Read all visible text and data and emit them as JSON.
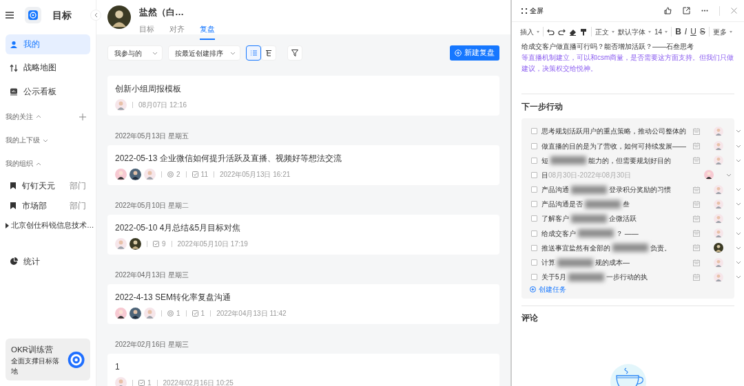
{
  "app": {
    "title": "目标"
  },
  "sidebar": {
    "nav": [
      {
        "label": "我的",
        "selected": true
      },
      {
        "label": "战略地图",
        "selected": false
      },
      {
        "label": "公示看板",
        "selected": false
      }
    ],
    "groups": [
      {
        "label": "我的关注",
        "expanded": true,
        "can_add": true
      },
      {
        "label": "我的上下级",
        "expanded": false,
        "can_add": false
      },
      {
        "label": "我的组织",
        "expanded": true,
        "can_add": false,
        "items": [
          {
            "kind": "dept",
            "label": "钉钉天元",
            "tag": "部门"
          },
          {
            "kind": "dept",
            "label": "市场部",
            "tag": "部门"
          },
          {
            "kind": "tree",
            "label": "北京创仕科锐信息技术…"
          }
        ]
      }
    ],
    "stats": {
      "label": "统计"
    },
    "promo": {
      "title": "OKR训练营",
      "subtitle": "全面支撑目标落地"
    }
  },
  "header": {
    "user": "盐然（白…",
    "tabs": [
      {
        "label": "目标",
        "selected": false
      },
      {
        "label": "对齐",
        "selected": false
      },
      {
        "label": "复盘",
        "selected": true
      }
    ]
  },
  "toolbar": {
    "filters": [
      "我参与的",
      "按最近创建排序"
    ],
    "views": [
      {
        "kind": "list",
        "selected": true
      },
      {
        "kind": "tree",
        "selected": false
      }
    ],
    "new_button": "新建复盘"
  },
  "reviews": [
    {
      "title": "创新小组周报模板",
      "time": "08月07日 12:16"
    },
    {
      "date": "2022年05月13日 星期五",
      "title": "2022-05-13 企业微信如何提升活跃及直播、视频好等想法交流",
      "objectives": "2",
      "tasks": "11",
      "time": "2022年05月13日 16:21"
    },
    {
      "date": "2022年05月10日 星期二",
      "title": "2022-05-10 4月总结&5月目标对焦",
      "tasks": "9",
      "time": "2022年05月10日 17:19"
    },
    {
      "date": "2022年04月13日 星期三",
      "title": "2022-4-13 SEM转化率复盘沟通",
      "objectives": "1",
      "tasks": "1",
      "time": "2022年04月13日 11:42"
    },
    {
      "date": "2022年02月16日 星期三",
      "title": "1",
      "tasks": "1",
      "time": "2022年02月16日 10:25"
    }
  ],
  "panel": {
    "fullscreen": "全屏",
    "editor_toolbar": [
      {
        "kind": "menu",
        "label": "插入"
      },
      {
        "kind": "sep"
      },
      {
        "kind": "icon"
      },
      {
        "kind": "icon"
      },
      {
        "kind": "icon"
      },
      {
        "kind": "icon"
      },
      {
        "kind": "sep"
      },
      {
        "kind": "menu",
        "label": "正文"
      },
      {
        "kind": "menu",
        "label": "默认字体"
      },
      {
        "kind": "menu",
        "label": "14"
      },
      {
        "kind": "sep"
      },
      {
        "kind": "format",
        "label": "B"
      },
      {
        "kind": "format",
        "label": "I"
      },
      {
        "kind": "format",
        "label": "U"
      },
      {
        "kind": "format",
        "label": "S"
      },
      {
        "kind": "sep"
      },
      {
        "kind": "menu",
        "label": "更多"
      }
    ],
    "paragraphs": [
      {
        "kind": "plain",
        "text": "给成交客户做直播可行吗？能否增加活跃？——石叁思考"
      },
      {
        "kind": "highlight",
        "text": "等直播机制建立，可以和csm商量，是否需要这方面支持。但我们只做建议，决策权交给悦神。"
      }
    ],
    "actions_title": "下一步行动",
    "tasks": [
      {
        "parts": [
          "思考规划活跃用户的重点策略，推动公司整体的"
        ],
        "checked": false
      },
      {
        "parts": [
          "做直播的目的是为了营收，如何可持续发展——"
        ],
        "checked": false
      },
      {
        "parts": [
          "短",
          "能力的，但需要规划好目的"
        ],
        "checked": false
      },
      {
        "parts": [
          "目"
        ],
        "due": "08月30日-2022年08月30日",
        "checked": false
      },
      {
        "parts": [
          "产品沟通",
          "登录积分奖励的习惯"
        ],
        "checked": false
      },
      {
        "parts": [
          "产品沟通是否",
          "叁"
        ],
        "checked": false
      },
      {
        "parts": [
          "了解客户",
          "企微活跃"
        ],
        "checked": false
      },
      {
        "parts": [
          "给成交客户",
          "？ ——"
        ],
        "checked": false
      },
      {
        "parts": [
          "推送事宜盐然有全部的",
          "负责。"
        ],
        "checked": false
      },
      {
        "parts": [
          "计算",
          "规的成本—"
        ],
        "checked": false
      },
      {
        "parts": [
          "关于5月",
          "一步行动的执"
        ],
        "checked": false
      }
    ],
    "create_task": "创建任务",
    "comments_title": "评论"
  }
}
